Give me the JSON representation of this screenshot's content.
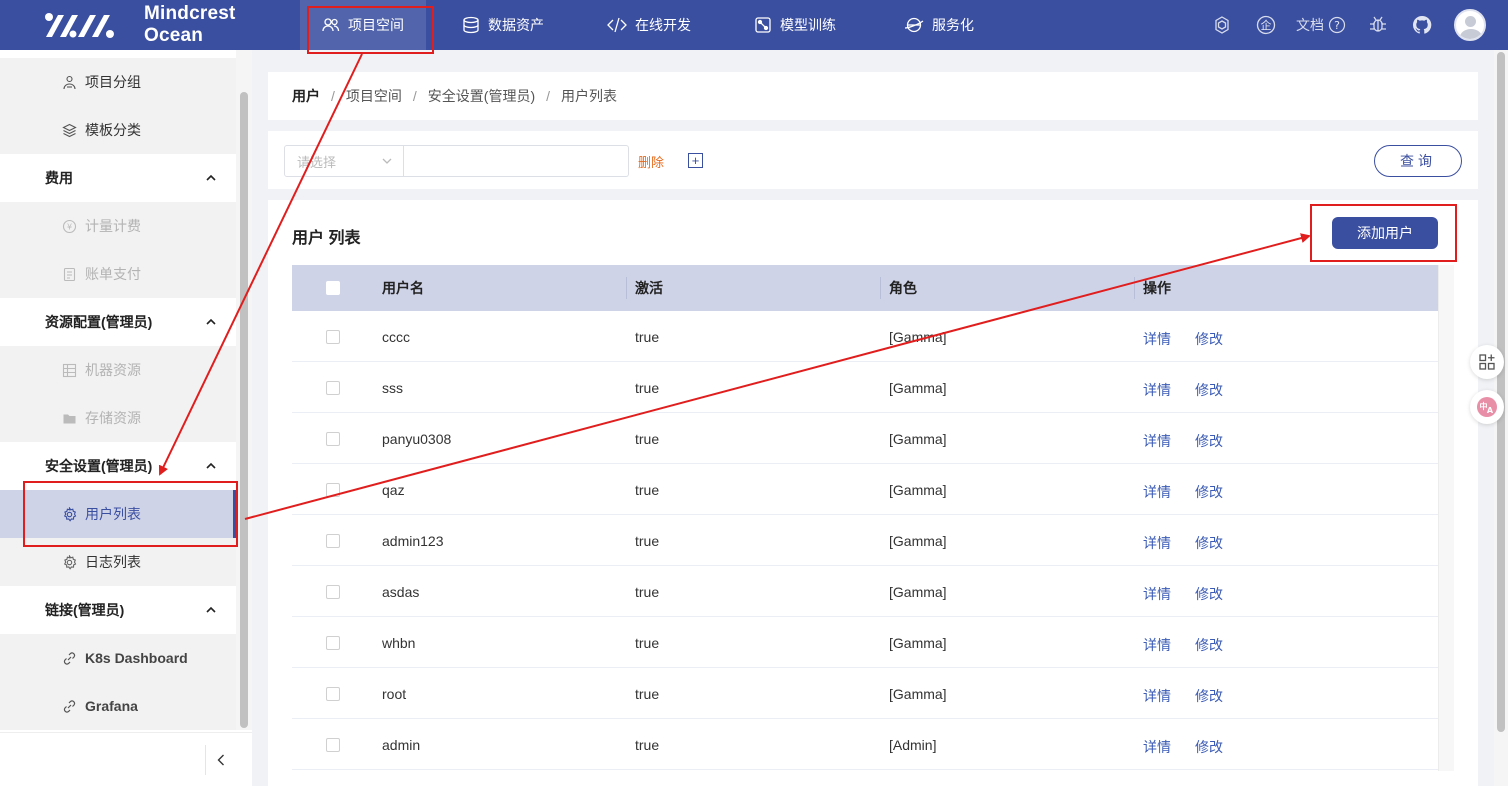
{
  "brand": {
    "name": "Mindcrest Ocean"
  },
  "nav": {
    "items": [
      {
        "label": "项目空间",
        "icon": "users-icon"
      },
      {
        "label": "数据资产",
        "icon": "database-icon"
      },
      {
        "label": "在线开发",
        "icon": "code-icon"
      },
      {
        "label": "模型训练",
        "icon": "model-icon"
      },
      {
        "label": "服务化",
        "icon": "service-icon"
      }
    ],
    "docs_label": "文档"
  },
  "sidebar": {
    "project_group": "项目分组",
    "template_category": "模板分类",
    "fee_group": "费用",
    "metering": "计量计费",
    "billing": "账单支付",
    "resource_group": "资源配置(管理员)",
    "machine_resource": "机器资源",
    "storage_resource": "存储资源",
    "security_group": "安全设置(管理员)",
    "user_list": "用户列表",
    "log_list": "日志列表",
    "link_group": "链接(管理员)",
    "k8s": "K8s Dashboard",
    "grafana": "Grafana"
  },
  "breadcrumb": {
    "b0": "用户",
    "b1": "项目空间",
    "b2": "安全设置(管理员)",
    "b3": "用户列表"
  },
  "filter": {
    "select_placeholder": "请选择",
    "delete_label": "删除",
    "add_label": "+",
    "query_label": "查询"
  },
  "list": {
    "title": "用户 列表",
    "add_button": "添加用户",
    "columns": {
      "username": "用户名",
      "active": "激活",
      "role": "角色",
      "actions": "操作"
    },
    "detail_label": "详情",
    "edit_label": "修改",
    "rows": [
      {
        "username": "cccc",
        "active": "true",
        "role": "[Gamma]"
      },
      {
        "username": "sss",
        "active": "true",
        "role": "[Gamma]"
      },
      {
        "username": "panyu0308",
        "active": "true",
        "role": "[Gamma]"
      },
      {
        "username": "qaz",
        "active": "true",
        "role": "[Gamma]"
      },
      {
        "username": "admin123",
        "active": "true",
        "role": "[Gamma]"
      },
      {
        "username": "asdas",
        "active": "true",
        "role": "[Gamma]"
      },
      {
        "username": "whbn",
        "active": "true",
        "role": "[Gamma]"
      },
      {
        "username": "root",
        "active": "true",
        "role": "[Gamma]"
      },
      {
        "username": "admin",
        "active": "true",
        "role": "[Admin]"
      }
    ]
  },
  "colors": {
    "primary": "#3b4fa0",
    "header_row": "#cfd3e8",
    "danger_text": "#e46a1c",
    "annotation": "#e01e1e"
  }
}
